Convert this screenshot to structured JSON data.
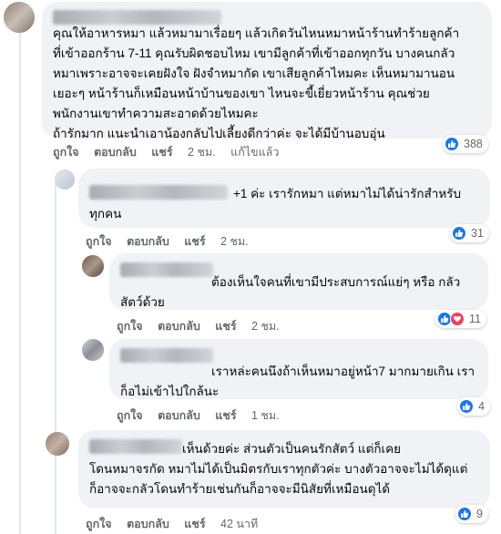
{
  "comments": [
    {
      "text": "คุณให้อาหารหมา แล้วหมามาเรื่อยๆ แล้วเกิดวันไหนหมาหน้าร้านทำร้ายลูกค้า\nที่เข้าออกร้าน 7-11 คุณรับผิดชอบไหม เขามีลูกค้าที่เข้าออกทุกวัน บางคนกลัว\nหมาเพราะอาจจะเคยฝังใจ ฝังจำหมากัด เขาเสียลูกค้าไหมคะ เห็นหมามานอน\nเยอะๆ หน้าร้านก็เหมือนหน้าบ้านของเขา ไหนจะขี้เยี่ยวหน้าร้าน คุณช่วย\nพนักงานเขาทำความสะอาดด้วยไหมคะ\nถ้ารักมาก แนะนำเอาน้องกลับไปเลี้ยงดีกว่าค่ะ จะได้มีบ้านอบอุ่น",
      "like": "ถูกใจ",
      "reply": "ตอบกลับ",
      "share": "แชร์",
      "time": "2 ชม.",
      "edited": "แก้ไขแล้ว",
      "reactions": "388"
    },
    {
      "text": "+1 ค่ะ เรารักหมา แต่หมาไม่ได้น่ารักสำหรับ\nทุกคน",
      "like": "ถูกใจ",
      "reply": "ตอบกลับ",
      "share": "แชร์",
      "time": "2 ชม.",
      "reactions": "31"
    },
    {
      "text": "ต้องเห็นใจคนที่เขามีประสบการณ์แย่ๆ หรือ กลัว\nสัตว์ด้วย",
      "like": "ถูกใจ",
      "reply": "ตอบกลับ",
      "share": "แชร์",
      "time": "2 ชม.",
      "reactions": "11"
    },
    {
      "text": "เราหล่ะคนนึงถ้าเห็นหมาอยู่หน้า7 มากมายเกิน เรา\nก็อไม่เข้าไปใกล้นะ",
      "like": "ถูกใจ",
      "reply": "ตอบกลับ",
      "share": "แชร์",
      "time": "1 ชม.",
      "reactions": "4"
    },
    {
      "text": "เห็นด้วยค่ะ ส่วนตัวเป็นคนรักสัตว์ แต่ก็เคย\nโดนหมาจรกัด หมาไม่ได้เป็นมิตรกับเราทุกตัวค่ะ บางตัวอาจจะไม่ได้ดุแต่\nก็อาจจะกลัวโดนทำร้ายเช่นกันก็อาจจะมีนิสัยที่เหมือนดุได้",
      "like": "ถูกใจ",
      "reply": "ตอบกลับ",
      "share": "แชร์",
      "time": "42 นาที",
      "reactions": "9"
    }
  ],
  "colors": {
    "bubble": "#f0f2f5",
    "meta": "#65676b",
    "like": "#1877f2",
    "love": "#f33e58"
  },
  "icons": {
    "like": "thumbs-up-icon",
    "love": "heart-icon"
  }
}
